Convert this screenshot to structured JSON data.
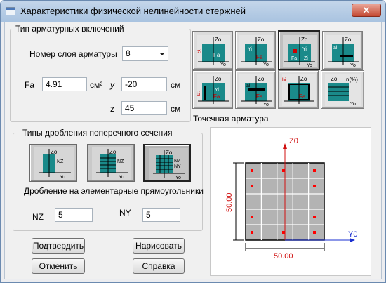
{
  "window": {
    "title": "Характеристики физической нелинейности стержней",
    "close_label": "✕"
  },
  "reinforcement": {
    "group_label": "Тип арматурных включений",
    "layer_label": "Номер слоя арматуры",
    "layer_value": "8",
    "fa_label": "Fa",
    "fa_value": "4.91",
    "fa_unit": "см²",
    "y_label": "y",
    "y_value": "-20",
    "y_unit": "см",
    "z_label": "z",
    "z_value": "45",
    "z_unit": "см",
    "type_caption": "Точечная арматура"
  },
  "split": {
    "group_label": "Типы дробления поперечного сечения",
    "caption": "Дробление на элементарные прямоугольники",
    "nz_label": "NZ",
    "nz_value": "5",
    "ny_label": "NY",
    "ny_value": "5"
  },
  "buttons": {
    "confirm": "Подтвердить",
    "draw": "Нарисовать",
    "cancel": "Отменить",
    "help": "Справка"
  },
  "preview": {
    "axis_z": "Z0",
    "axis_y": "Y0",
    "dim_width": "50.00",
    "dim_height": "50.00",
    "grid_color": "#6e6e6e",
    "rebar_color": "#ff0000",
    "axis_color": "#d01010",
    "axis_y_color": "#1a2fd0"
  },
  "icons": {
    "tile_labels": {
      "zo": "Zo",
      "yo": "Yo",
      "fa": "Fa",
      "yi": "Yi",
      "zi": "Zi",
      "ai": "ai",
      "bi": "bi",
      "n": "n(%)",
      "nz": "NZ",
      "ny": "NY"
    }
  }
}
